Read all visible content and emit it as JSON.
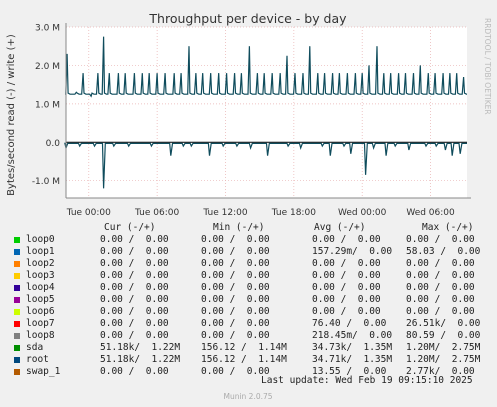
{
  "chart_data": {
    "type": "line",
    "title": "Throughput per device - by day",
    "ylabel": "Bytes/second read (-) / write (+)",
    "side_label": "RRDTOOL / TOBI OETIKER",
    "footer": "Munin 2.0.75",
    "y_ticks": [
      "3.0 M",
      "2.0 M",
      "1.0 M",
      "0.0",
      "-1.0 M"
    ],
    "y_tick_values": [
      3000000,
      2000000,
      1000000,
      0,
      -1000000
    ],
    "ylim": [
      -1450000,
      3000000
    ],
    "x_ticks": [
      "Tue 00:00",
      "Tue 06:00",
      "Tue 12:00",
      "Tue 18:00",
      "Wed 00:00",
      "Wed 06:00"
    ],
    "x_tick_hours": [
      0,
      6,
      12,
      18,
      24,
      30
    ],
    "xlim_hours": [
      -2,
      33.2
    ],
    "grid": true,
    "series": [
      {
        "name": "root",
        "color": "#0f4c5c",
        "description": "write (+) baseline ~1.25M with periodic spikes up to ~2.75M; read (-) near 0 with dips to ~-1.2M",
        "write_spikes": [
          [
            -1.9,
            2.3
          ],
          [
            -1.1,
            1.3
          ],
          [
            -0.5,
            1.8
          ],
          [
            0.2,
            1.2
          ],
          [
            0.8,
            1.8
          ],
          [
            1.3,
            2.75
          ],
          [
            1.8,
            1.8
          ],
          [
            2.6,
            1.8
          ],
          [
            3.2,
            1.8
          ],
          [
            4.0,
            1.8
          ],
          [
            4.7,
            1.8
          ],
          [
            5.3,
            1.8
          ],
          [
            6.0,
            1.8
          ],
          [
            6.7,
            1.8
          ],
          [
            7.5,
            1.8
          ],
          [
            8.1,
            1.8
          ],
          [
            8.8,
            2.5
          ],
          [
            9.4,
            1.8
          ],
          [
            10.0,
            1.8
          ],
          [
            10.7,
            1.8
          ],
          [
            11.4,
            1.8
          ],
          [
            12.1,
            1.8
          ],
          [
            12.8,
            1.8
          ],
          [
            13.4,
            1.8
          ],
          [
            14.1,
            2.5
          ],
          [
            14.8,
            1.8
          ],
          [
            15.4,
            1.8
          ],
          [
            16.1,
            1.8
          ],
          [
            16.8,
            1.8
          ],
          [
            17.4,
            2.25
          ],
          [
            18.1,
            1.8
          ],
          [
            18.8,
            1.8
          ],
          [
            19.4,
            2.5
          ],
          [
            20.1,
            1.8
          ],
          [
            20.7,
            1.8
          ],
          [
            21.4,
            1.8
          ],
          [
            22.0,
            1.8
          ],
          [
            22.7,
            1.8
          ],
          [
            23.4,
            1.8
          ],
          [
            24.0,
            1.8
          ],
          [
            24.6,
            2.0
          ],
          [
            25.3,
            2.5
          ],
          [
            25.9,
            1.8
          ],
          [
            26.5,
            1.8
          ],
          [
            27.2,
            1.8
          ],
          [
            27.8,
            1.8
          ],
          [
            28.5,
            1.8
          ],
          [
            29.1,
            2.0
          ],
          [
            29.8,
            1.8
          ],
          [
            30.4,
            1.8
          ],
          [
            31.1,
            1.8
          ],
          [
            31.7,
            1.8
          ],
          [
            32.3,
            1.8
          ],
          [
            32.9,
            1.7
          ]
        ],
        "read_dips": [
          [
            -2.0,
            -0.15
          ],
          [
            -0.8,
            -0.1
          ],
          [
            0.5,
            -0.1
          ],
          [
            1.3,
            -1.2
          ],
          [
            2.2,
            -0.1
          ],
          [
            3.5,
            -0.1
          ],
          [
            5.5,
            -0.1
          ],
          [
            7.2,
            -0.35
          ],
          [
            8.3,
            -0.1
          ],
          [
            9.0,
            -0.1
          ],
          [
            10.6,
            -0.35
          ],
          [
            11.8,
            -0.1
          ],
          [
            13.0,
            -0.1
          ],
          [
            14.2,
            -0.15
          ],
          [
            15.7,
            -0.35
          ],
          [
            17.5,
            -0.1
          ],
          [
            18.6,
            -0.15
          ],
          [
            20.5,
            -0.1
          ],
          [
            21.2,
            -0.35
          ],
          [
            22.4,
            -0.1
          ],
          [
            23.0,
            -0.3
          ],
          [
            24.3,
            -0.85
          ],
          [
            25.0,
            -0.15
          ],
          [
            26.1,
            -0.35
          ],
          [
            26.9,
            -0.1
          ],
          [
            28.1,
            -0.2
          ],
          [
            29.6,
            -0.1
          ],
          [
            30.5,
            -0.1
          ],
          [
            31.3,
            -0.2
          ],
          [
            31.9,
            -0.35
          ],
          [
            32.6,
            -0.3
          ]
        ]
      }
    ]
  },
  "legend": {
    "headers": [
      "Cur (-/+)",
      "Min (-/+)",
      "Avg (-/+)",
      "Max (-/+)"
    ],
    "rows": [
      {
        "name": "loop0",
        "color": "#00cc00",
        "cur": "0.00 /  0.00",
        "min": "0.00 /  0.00",
        "avg": "0.00 /  0.00",
        "max": "0.00 /  0.00"
      },
      {
        "name": "loop1",
        "color": "#0066b3",
        "cur": "0.00 /  0.00",
        "min": "0.00 /  0.00",
        "avg": "157.29m/  0.00",
        "max": "58.03 /  0.00"
      },
      {
        "name": "loop2",
        "color": "#ff8000",
        "cur": "0.00 /  0.00",
        "min": "0.00 /  0.00",
        "avg": "0.00 /  0.00",
        "max": "0.00 /  0.00"
      },
      {
        "name": "loop3",
        "color": "#ffcc00",
        "cur": "0.00 /  0.00",
        "min": "0.00 /  0.00",
        "avg": "0.00 /  0.00",
        "max": "0.00 /  0.00"
      },
      {
        "name": "loop4",
        "color": "#330099",
        "cur": "0.00 /  0.00",
        "min": "0.00 /  0.00",
        "avg": "0.00 /  0.00",
        "max": "0.00 /  0.00"
      },
      {
        "name": "loop5",
        "color": "#990099",
        "cur": "0.00 /  0.00",
        "min": "0.00 /  0.00",
        "avg": "0.00 /  0.00",
        "max": "0.00 /  0.00"
      },
      {
        "name": "loop6",
        "color": "#ccff00",
        "cur": "0.00 /  0.00",
        "min": "0.00 /  0.00",
        "avg": "0.00 /  0.00",
        "max": "0.00 /  0.00"
      },
      {
        "name": "loop7",
        "color": "#ff0000",
        "cur": "0.00 /  0.00",
        "min": "0.00 /  0.00",
        "avg": "76.40 /  0.00",
        "max": "26.51k/  0.00"
      },
      {
        "name": "loop8",
        "color": "#808080",
        "cur": "0.00 /  0.00",
        "min": "0.00 /  0.00",
        "avg": "218.45m/  0.00",
        "max": "80.59 /  0.00"
      },
      {
        "name": "sda",
        "color": "#008f00",
        "cur": "51.18k/  1.22M",
        "min": "156.12 /  1.14M",
        "avg": "34.73k/  1.35M",
        "max": "1.20M/  2.75M"
      },
      {
        "name": "root",
        "color": "#00487d",
        "cur": "51.18k/  1.22M",
        "min": "156.12 /  1.14M",
        "avg": "34.71k/  1.35M",
        "max": "1.20M/  2.75M"
      },
      {
        "name": "swap_1",
        "color": "#b35a00",
        "cur": "0.00 /  0.00",
        "min": "0.00 /  0.00",
        "avg": "13.55 /  0.00",
        "max": "2.77k/  0.00"
      }
    ],
    "last_update": "Last update: Wed Feb 19 09:15:10 2025"
  }
}
